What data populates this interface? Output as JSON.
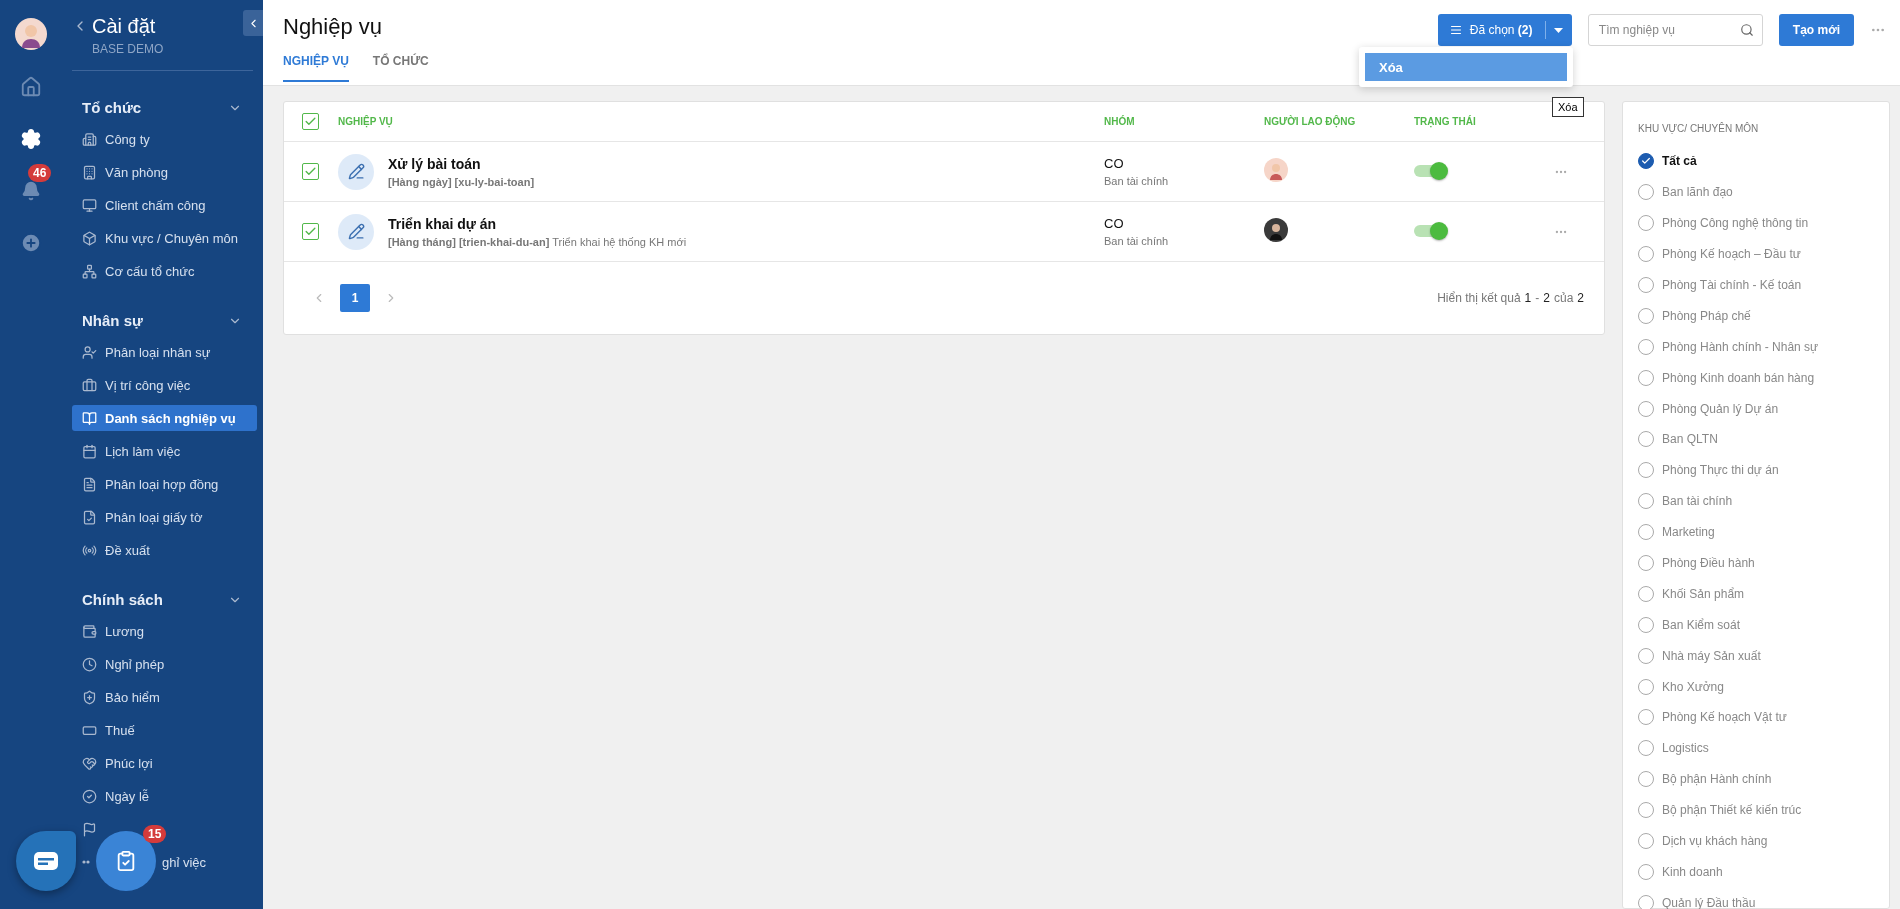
{
  "rail": {
    "notification_badge": "46"
  },
  "settings_panel": {
    "title": "Cài đặt",
    "subtitle": "BASE DEMO"
  },
  "sidebar": {
    "sections": [
      {
        "title": "Tổ chức",
        "expanded": true,
        "items": [
          {
            "label": "Công ty",
            "selected": false
          },
          {
            "label": "Văn phòng",
            "selected": false
          },
          {
            "label": "Client chấm công",
            "selected": false
          },
          {
            "label": "Khu vực / Chuyên môn",
            "selected": false
          },
          {
            "label": "Cơ cấu tổ chức",
            "selected": false
          }
        ]
      },
      {
        "title": "Nhân sự",
        "expanded": true,
        "items": [
          {
            "label": "Phân loại nhân sự",
            "selected": false
          },
          {
            "label": "Vị trí công việc",
            "selected": false
          },
          {
            "label": "Danh sách nghiệp vụ",
            "selected": true
          },
          {
            "label": "Lịch làm việc",
            "selected": false
          },
          {
            "label": "Phân loại hợp đồng",
            "selected": false
          },
          {
            "label": "Phân loại giấy tờ",
            "selected": false
          },
          {
            "label": "Đề xuất",
            "selected": false
          }
        ]
      },
      {
        "title": "Chính sách",
        "expanded": true,
        "items": [
          {
            "label": "Lương",
            "selected": false
          },
          {
            "label": "Nghỉ phép",
            "selected": false
          },
          {
            "label": "Bảo hiểm",
            "selected": false
          },
          {
            "label": "Thuế",
            "selected": false
          },
          {
            "label": "Phúc lợi",
            "selected": false
          },
          {
            "label": "Ngày lễ",
            "selected": false
          },
          {
            "kind": "icon_only",
            "selected": false
          },
          {
            "kind": "partly_hidden",
            "label": "ghỉ việc",
            "selected": false
          }
        ]
      }
    ]
  },
  "floating": {
    "task_badge": "15"
  },
  "header": {
    "title": "Nghiệp vụ",
    "tabs": [
      {
        "label": "NGHIỆP VỤ",
        "selected": true
      },
      {
        "label": "TỔ CHỨC",
        "selected": false
      }
    ],
    "selected_button": {
      "label": "Đã chọn",
      "count": "(2)"
    },
    "menu": {
      "items": [
        {
          "label": "Xóa",
          "selected": true
        }
      ]
    },
    "search": {
      "placeholder": "Tìm nghiệp vụ"
    },
    "create_button": "Tạo mới"
  },
  "tooltip": "Xóa",
  "table": {
    "all_checked": true,
    "columns": [
      "NGHIỆP VỤ",
      "NHÓM",
      "NGƯỜI LAO ĐỘNG",
      "TRẠNG THÁI"
    ],
    "rows": [
      {
        "checked": true,
        "title": "Xử lý bài toán",
        "tags": "**[Hàng ngày] [xu-ly-bai-toan]**",
        "group": "CO",
        "department": "Ban tài chính",
        "on": true
      },
      {
        "checked": true,
        "title": "Triển khai dự án",
        "tags": "**[Hàng tháng] [trien-khai-du-an]** Triển khai hệ thống KH mới",
        "group": "CO",
        "department": "Ban tài chính",
        "on": true
      }
    ],
    "pagination": {
      "pages": [
        {
          "label": "1",
          "selected": true
        }
      ],
      "summary": {
        "prefix": "Hiển thị kết quả",
        "from": "1",
        "sep": "-",
        "to": "2",
        "of": "của",
        "total": "2"
      }
    }
  },
  "filter": {
    "title": "KHU VỰC/ CHUYÊN MÔN",
    "options": [
      {
        "label": "Tất cả",
        "selected": true
      },
      {
        "label": "Ban lãnh đạo",
        "selected": false
      },
      {
        "label": "Phòng Công nghệ thông tin",
        "selected": false
      },
      {
        "label": "Phòng Kế hoạch – Đầu tư",
        "selected": false
      },
      {
        "label": "Phòng Tài chính - Kế toán",
        "selected": false
      },
      {
        "label": "Phòng Pháp chế",
        "selected": false
      },
      {
        "label": "Phòng Hành chính - Nhân sự",
        "selected": false
      },
      {
        "label": "Phòng Kinh doanh bán hàng",
        "selected": false
      },
      {
        "label": "Phòng Quản lý Dự án",
        "selected": false
      },
      {
        "label": "Ban QLTN",
        "selected": false
      },
      {
        "label": "Phòng Thực thi dự án",
        "selected": false
      },
      {
        "label": "Ban tài chính",
        "selected": false
      },
      {
        "label": "Marketing",
        "selected": false
      },
      {
        "label": "Phòng Điều hành",
        "selected": false
      },
      {
        "label": "Khối Sản phẩm",
        "selected": false
      },
      {
        "label": "Ban Kiểm soát",
        "selected": false
      },
      {
        "label": "Nhà máy Sản xuất",
        "selected": false
      },
      {
        "label": "Kho Xưởng",
        "selected": false
      },
      {
        "label": "Phòng Kế hoạch Vật tư",
        "selected": false
      },
      {
        "label": "Logistics",
        "selected": false
      },
      {
        "label": "Bộ phận Hành chính",
        "selected": false
      },
      {
        "label": "Bộ phận Thiết kế kiến trúc",
        "selected": false
      },
      {
        "label": "Dịch vụ khách hàng",
        "selected": false
      },
      {
        "label": "Kinh doanh",
        "selected": false
      },
      {
        "label": "Quản lý Đầu thầu",
        "selected": false
      }
    ]
  }
}
